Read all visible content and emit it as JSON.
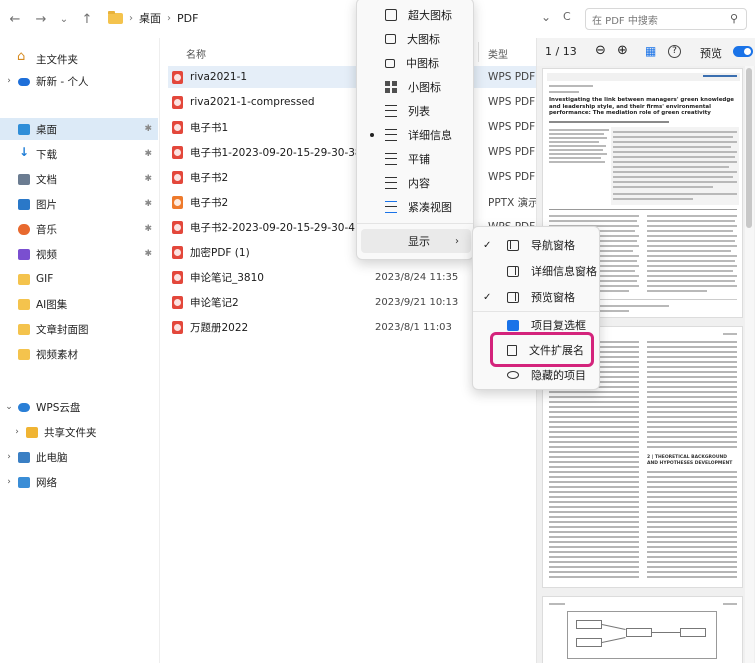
{
  "nav": {
    "back_icon": "←",
    "forward_icon": "→",
    "recent_icon": "⌄",
    "up_icon": "↑"
  },
  "breadcrumb": {
    "items": [
      "桌面",
      "PDF"
    ],
    "separator": "›"
  },
  "address": {
    "dropdown_icon": "⌄",
    "refresh_icon": "C"
  },
  "search": {
    "placeholder": "在 PDF 中搜索",
    "icon": "⚲"
  },
  "sidebar": {
    "items": [
      {
        "label": "主文件夹",
        "icon": "home-icon",
        "chevron": ""
      },
      {
        "label": "新新 - 个人",
        "icon": "cloud-icon",
        "chevron": "›"
      },
      {
        "label": "桌面",
        "icon": "desktop-icon",
        "pin": "✱"
      },
      {
        "label": "下载",
        "icon": "download-icon",
        "pin": "✱"
      },
      {
        "label": "文档",
        "icon": "document-icon",
        "pin": "✱"
      },
      {
        "label": "图片",
        "icon": "pictures-icon",
        "pin": "✱"
      },
      {
        "label": "音乐",
        "icon": "music-icon",
        "pin": "✱"
      },
      {
        "label": "视频",
        "icon": "video-icon",
        "pin": "✱"
      },
      {
        "label": "GIF",
        "icon": "folder-icon"
      },
      {
        "label": "AI图集",
        "icon": "folder-icon"
      },
      {
        "label": "文章封面图",
        "icon": "folder-icon"
      },
      {
        "label": "视频素材",
        "icon": "folder-icon"
      },
      {
        "label": "WPS云盘",
        "icon": "wps-cloud-icon",
        "chevron": "⌄"
      },
      {
        "label": "共享文件夹",
        "icon": "shared-folder-icon",
        "chevron": "›"
      },
      {
        "label": "此电脑",
        "icon": "this-pc-icon",
        "chevron": "›"
      },
      {
        "label": "网络",
        "icon": "network-icon",
        "chevron": "›"
      }
    ]
  },
  "filelist": {
    "columns": {
      "name": "名称",
      "type": "类型"
    },
    "sort_caret": "^",
    "rows": [
      {
        "name": "riva2021-1",
        "date": "",
        "type": "WPS PDF"
      },
      {
        "name": "riva2021-1-compressed",
        "date": "",
        "type": "WPS PDF"
      },
      {
        "name": "电子书1",
        "date": "",
        "type": "WPS PDF"
      },
      {
        "name": "电子书1-2023-09-20-15-29-30-383-20",
        "date": "",
        "type": "WPS PDF"
      },
      {
        "name": "电子书2",
        "date": "",
        "type": "WPS PDF"
      },
      {
        "name": "电子书2",
        "date": "",
        "type": "PPTX 演示"
      },
      {
        "name": "电子书2-2023-09-20-15-29-30-415-20",
        "date": "",
        "type": "WPS PDF"
      },
      {
        "name": "加密PDF (1)",
        "date": "",
        "type": ""
      },
      {
        "name": "申论笔记_3810",
        "date": "2023/8/24 11:35",
        "type": ""
      },
      {
        "name": "申论笔记2",
        "date": "2023/9/21 10:13",
        "type": ""
      },
      {
        "name": "万题册2022",
        "date": "2023/8/1 11:03",
        "type": ""
      }
    ]
  },
  "preview": {
    "page_indicator": "1 / 13",
    "zoom_out_icon": "⊖",
    "zoom_in_icon": "⊕",
    "grid_icon": "▦",
    "help_icon": "?",
    "preview_label": "预览",
    "article_title": "Investigating the link between managers' green knowledge and leadership style, and their firms' environmental performance: The mediation role of green creativity",
    "section_heading": "2 | THEORETICAL BACKGROUND AND HYPOTHESES DEVELOPMENT",
    "accent_color": "#1a73e8"
  },
  "view_menu": {
    "items": [
      {
        "label": "超大图标",
        "icon": "extra-large-icons-icon"
      },
      {
        "label": "大图标",
        "icon": "large-icons-icon"
      },
      {
        "label": "中图标",
        "icon": "medium-icons-icon"
      },
      {
        "label": "小图标",
        "icon": "small-icons-icon"
      },
      {
        "label": "列表",
        "icon": "list-icon"
      },
      {
        "label": "详细信息",
        "icon": "details-icon",
        "selected": true
      },
      {
        "label": "平铺",
        "icon": "tiles-icon"
      },
      {
        "label": "内容",
        "icon": "content-icon"
      },
      {
        "label": "紧凑视图",
        "icon": "compact-view-icon"
      },
      {
        "label": "显示",
        "icon": "",
        "arrow": "›"
      }
    ]
  },
  "show_menu": {
    "items": [
      {
        "label": "导航窗格",
        "checked": true,
        "icon": "navigation-pane-icon"
      },
      {
        "label": "详细信息窗格",
        "checked": false,
        "icon": "details-pane-icon"
      },
      {
        "label": "预览窗格",
        "checked": true,
        "icon": "preview-pane-icon"
      },
      {
        "label": "项目复选框",
        "checked": false,
        "icon": "item-checkbox-icon"
      },
      {
        "label": "文件扩展名",
        "checked": false,
        "icon": "file-extension-icon"
      },
      {
        "label": "隐藏的项目",
        "checked": false,
        "icon": "hidden-items-icon"
      }
    ],
    "check_glyph": "✓",
    "highlight_color": "#d4247c"
  }
}
